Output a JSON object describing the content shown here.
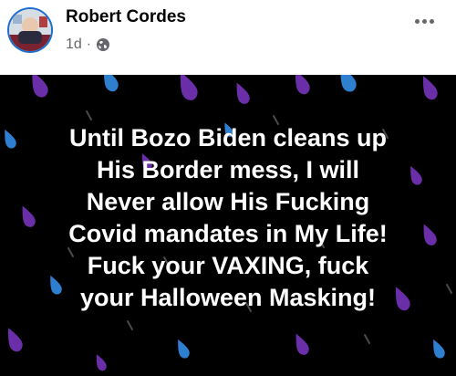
{
  "post": {
    "author_name": "Robert Cordes",
    "timestamp": "1d",
    "separator": "·",
    "privacy_icon": "globe-icon",
    "more_icon": "more-options-icon",
    "text": "Until Bozo Biden cleans up\nHis Border mess, I will\nNever allow His Fucking\nCovid mandates in My Life!\nFuck your VAXING,  fuck\nyour Halloween Masking!"
  },
  "colors": {
    "background": "#000000",
    "text": "#ffffff",
    "raindrop_purple": "#6a2fa8",
    "raindrop_blue": "#2f7fd0",
    "avatar_ring": "#1b6fd0"
  }
}
